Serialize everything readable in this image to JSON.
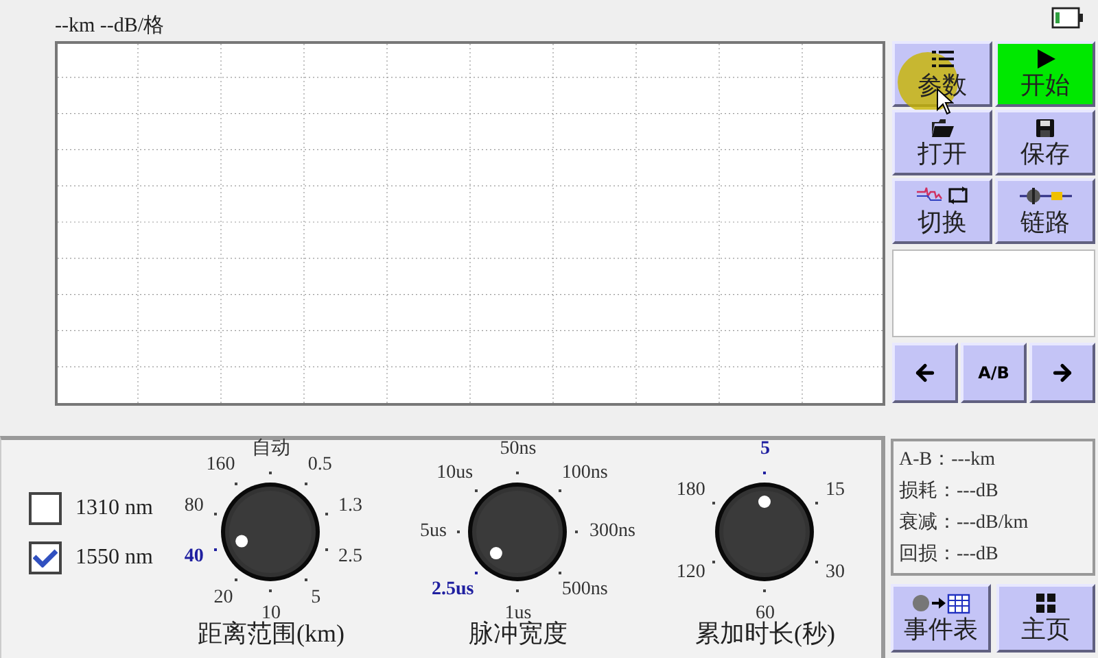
{
  "header": {
    "scale_label": "--km --dB/格"
  },
  "buttons": [
    {
      "label": "参数",
      "kind": "params",
      "highlighted": false,
      "hovered": true
    },
    {
      "label": "开始",
      "kind": "start",
      "highlighted": true,
      "hovered": false
    },
    {
      "label": "打开",
      "kind": "open",
      "highlighted": false,
      "hovered": false
    },
    {
      "label": "保存",
      "kind": "save",
      "highlighted": false,
      "hovered": false
    },
    {
      "label": "切换",
      "kind": "switch",
      "highlighted": false,
      "hovered": false
    },
    {
      "label": "链路",
      "kind": "link",
      "highlighted": false,
      "hovered": false
    }
  ],
  "nav_buttons": [
    {
      "kind": "prev"
    },
    {
      "kind": "ab",
      "label": "A/B"
    },
    {
      "kind": "next"
    }
  ],
  "wavelengths": [
    {
      "label": "1310 nm",
      "checked": false
    },
    {
      "label": "1550 nm",
      "checked": true
    }
  ],
  "knobs": [
    {
      "title": "距离范围(km)",
      "ticks": [
        {
          "label": "自动",
          "selected": false
        },
        {
          "label": "0.5",
          "selected": false
        },
        {
          "label": "1.3",
          "selected": false
        },
        {
          "label": "2.5",
          "selected": false
        },
        {
          "label": "5",
          "selected": false
        },
        {
          "label": "10",
          "selected": false
        },
        {
          "label": "20",
          "selected": false
        },
        {
          "label": "40",
          "selected": true
        },
        {
          "label": "80",
          "selected": false
        },
        {
          "label": "160",
          "selected": false
        }
      ]
    },
    {
      "title": "脉冲宽度",
      "ticks": [
        {
          "label": "50ns",
          "selected": false
        },
        {
          "label": "100ns",
          "selected": false
        },
        {
          "label": "300ns",
          "selected": false
        },
        {
          "label": "500ns",
          "selected": false
        },
        {
          "label": "1us",
          "selected": false
        },
        {
          "label": "2.5us",
          "selected": true
        },
        {
          "label": "5us",
          "selected": false
        },
        {
          "label": "10us",
          "selected": false
        }
      ]
    },
    {
      "title": "累加时长(秒)",
      "ticks": [
        {
          "label": "5",
          "selected": true
        },
        {
          "label": "15",
          "selected": false
        },
        {
          "label": "30",
          "selected": false
        },
        {
          "label": "60",
          "selected": false
        },
        {
          "label": "120",
          "selected": false
        },
        {
          "label": "180",
          "selected": false
        }
      ]
    }
  ],
  "readings": [
    {
      "label": "A-B：",
      "value": "---km"
    },
    {
      "label": "损耗：",
      "value": "---dB"
    },
    {
      "label": "衰减：",
      "value": "---dB/km"
    },
    {
      "label": "回损：",
      "value": "---dB"
    }
  ],
  "bottom_buttons": [
    {
      "label": "事件表",
      "kind": "events"
    },
    {
      "label": "主页",
      "kind": "home"
    }
  ]
}
